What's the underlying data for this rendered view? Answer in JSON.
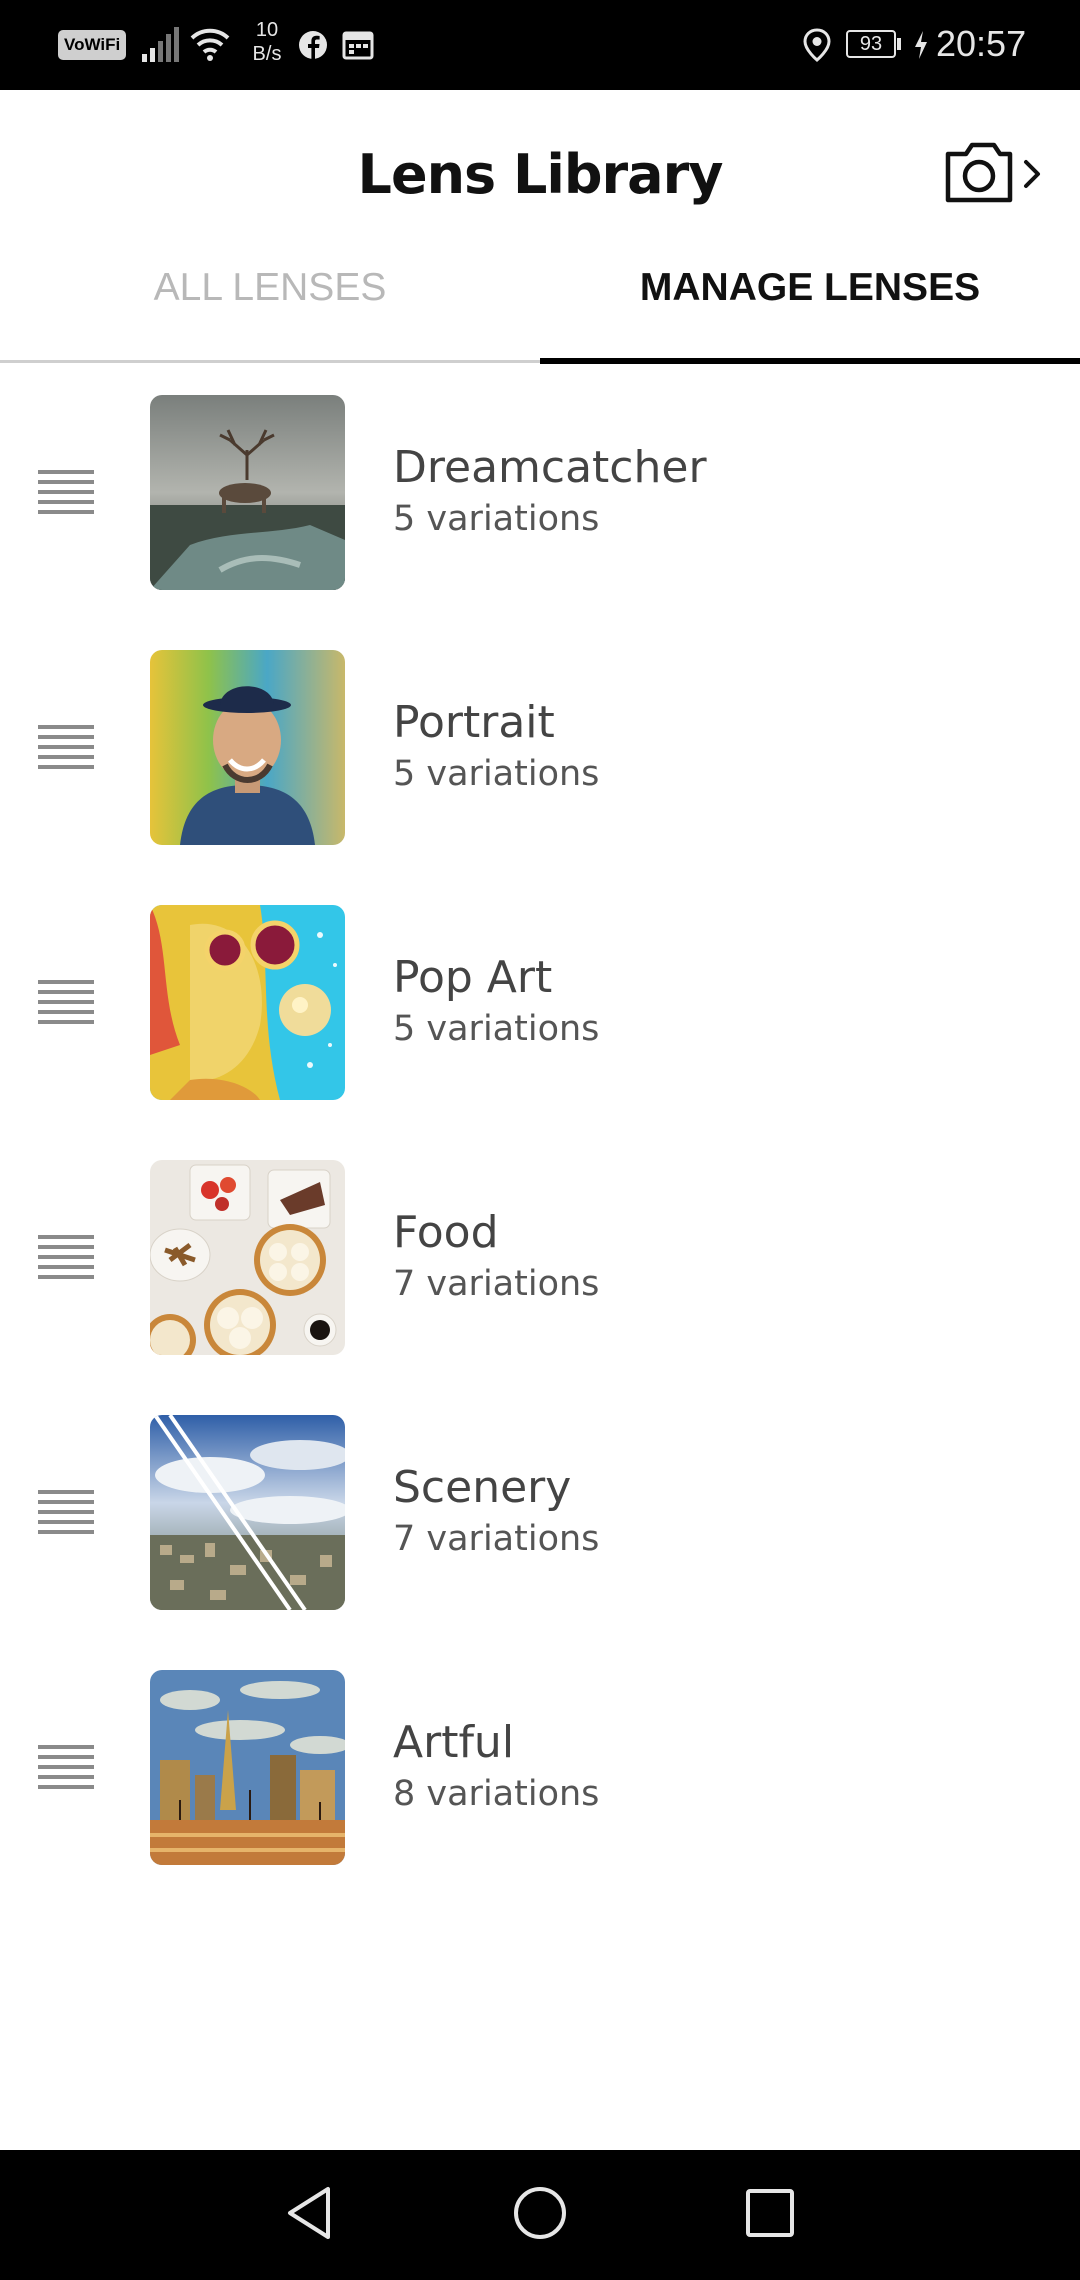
{
  "status_bar": {
    "vowifi": "VoWiFi",
    "speed_value": "10",
    "speed_unit": "B/s",
    "battery": "93",
    "time": "20:57"
  },
  "header": {
    "title": "Lens Library"
  },
  "tabs": [
    {
      "label": "ALL LENSES",
      "active": false
    },
    {
      "label": "MANAGE LENSES",
      "active": true
    }
  ],
  "lenses": [
    {
      "name": "Dreamcatcher",
      "variations": "5 variations"
    },
    {
      "name": "Portrait",
      "variations": "5 variations"
    },
    {
      "name": "Pop Art",
      "variations": "5 variations"
    },
    {
      "name": "Food",
      "variations": "7 variations"
    },
    {
      "name": "Scenery",
      "variations": "7 variations"
    },
    {
      "name": "Artful",
      "variations": "8 variations"
    }
  ],
  "colors": {
    "active_tab": "#111111",
    "inactive_tab": "#b8b8b8",
    "tab_indicator": "#000000"
  }
}
